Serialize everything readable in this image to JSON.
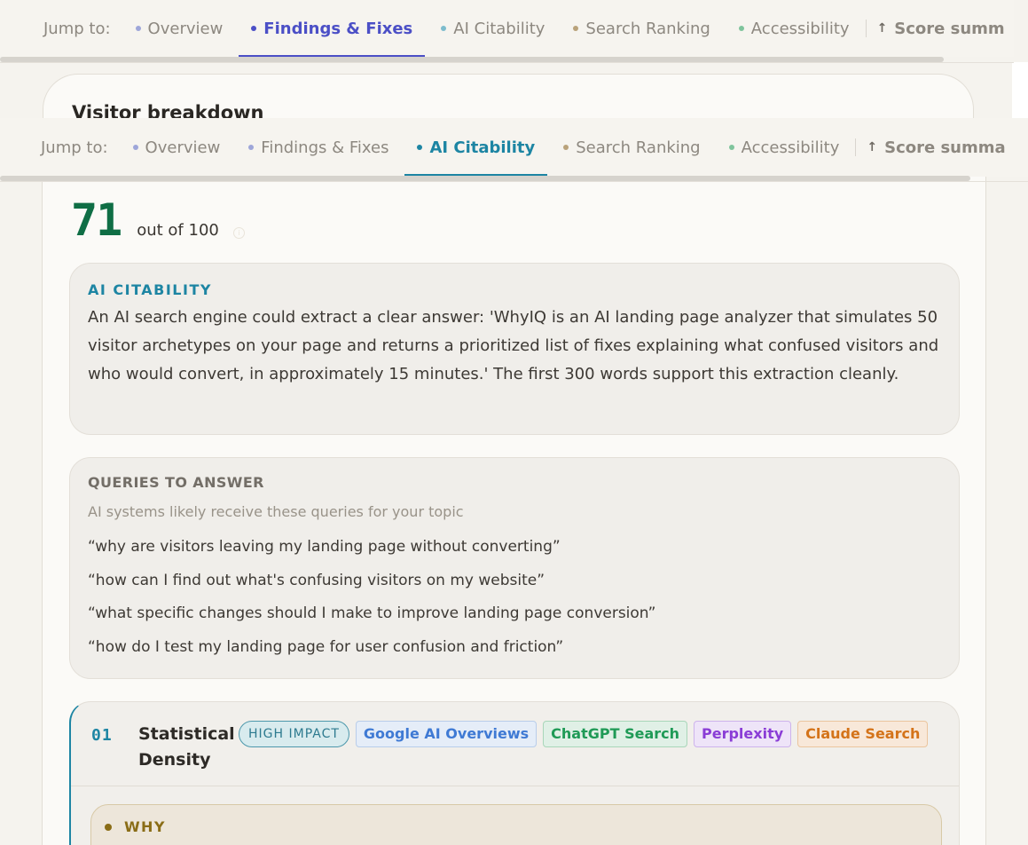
{
  "nav_top": {
    "jump_label": "Jump to:",
    "items": [
      {
        "label": "Overview",
        "color": "#9ea6d9",
        "active": false
      },
      {
        "label": "Findings & Fixes",
        "color": "#4b4fc6",
        "active": true
      },
      {
        "label": "AI Citability",
        "color": "#7dbccd",
        "active": false
      },
      {
        "label": "Search Ranking",
        "color": "#b9a27a",
        "active": false
      },
      {
        "label": "Accessibility",
        "color": "#7fc49c",
        "active": false
      }
    ],
    "score_label": "Score summ",
    "score_arrow": "↑"
  },
  "nav_bottom": {
    "jump_label": "Jump to:",
    "items": [
      {
        "label": "Overview",
        "color": "#9ea6d9",
        "active": false
      },
      {
        "label": "Findings & Fixes",
        "color": "#9ea6d9",
        "active": false
      },
      {
        "label": "AI Citability",
        "color": "#1d85a3",
        "active": true
      },
      {
        "label": "Search Ranking",
        "color": "#b9a27a",
        "active": false
      },
      {
        "label": "Accessibility",
        "color": "#7fc49c",
        "active": false
      }
    ],
    "score_label": "Score summa",
    "score_arrow": "↑"
  },
  "back_card": {
    "title": "Visitor breakdown"
  },
  "score": {
    "value": "71",
    "out_of": "out of 100",
    "color": "#0f6e45",
    "info_icon": "info-icon"
  },
  "ai_citability": {
    "label": "AI CITABILITY",
    "body": "An AI search engine could extract a clear answer: 'WhyIQ is an AI landing page analyzer that simulates 50 visitor archetypes on your page and returns a prioritized list of fixes explaining what confused visitors and who would convert, in approximately 15 minutes.' The first 300 words support this extraction cleanly."
  },
  "queries": {
    "label": "QUERIES TO ANSWER",
    "subtitle": "AI systems likely receive these queries for your topic",
    "items": [
      "“why are visitors leaving my landing page without converting”",
      "“how can I find out what's confusing visitors on my website”",
      "“what specific changes should I make to improve landing page conversion”",
      "“how do I test my landing page for user confusion and friction”"
    ]
  },
  "recommendation": {
    "number": "01",
    "title": "Statistical Density",
    "impact": "HIGH IMPACT",
    "engines": [
      "Google AI Overviews",
      "ChatGPT Search",
      "Perplexity",
      "Claude Search"
    ],
    "why_label": "WHY"
  }
}
